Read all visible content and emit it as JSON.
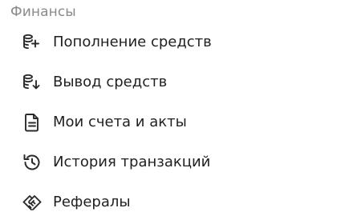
{
  "section": {
    "title": "Финансы"
  },
  "menu": {
    "items": [
      {
        "label": "Пополнение средств",
        "icon": "coins-plus-icon"
      },
      {
        "label": "Вывод средств",
        "icon": "coins-withdraw-icon"
      },
      {
        "label": "Мои счета и акты",
        "icon": "document-icon"
      },
      {
        "label": "История транзакций",
        "icon": "history-icon"
      },
      {
        "label": "Рефералы",
        "icon": "handshake-icon"
      }
    ]
  },
  "colors": {
    "text": "#1f1f1f",
    "muted": "#8a8a8a",
    "icon": "#2b2b2b"
  }
}
